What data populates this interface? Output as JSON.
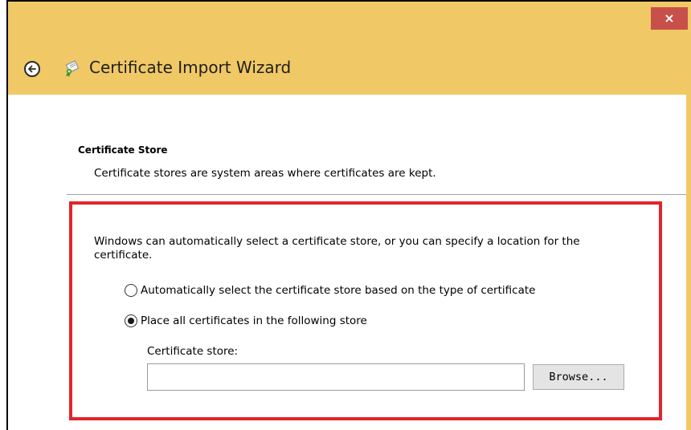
{
  "window": {
    "title": "Certificate Import Wizard",
    "close_label": "×"
  },
  "icons": {
    "back": "back-arrow-icon",
    "certificate": "certificate-icon"
  },
  "section": {
    "heading": "Certificate Store",
    "description": "Certificate stores are system areas where certificates are kept."
  },
  "body": {
    "intro": "Windows can automatically select a certificate store, or you can specify a location for the certificate.",
    "options": [
      {
        "label": "Automatically select the certificate store based on the type of certificate",
        "selected": false
      },
      {
        "label": "Place all certificates in the following store",
        "selected": true
      }
    ],
    "store_label": "Certificate store:",
    "store_value": "",
    "browse_label": "Browse..."
  },
  "colors": {
    "titlebar": "#f1c866",
    "close_button": "#c7504a",
    "highlight": "#e3242b"
  }
}
